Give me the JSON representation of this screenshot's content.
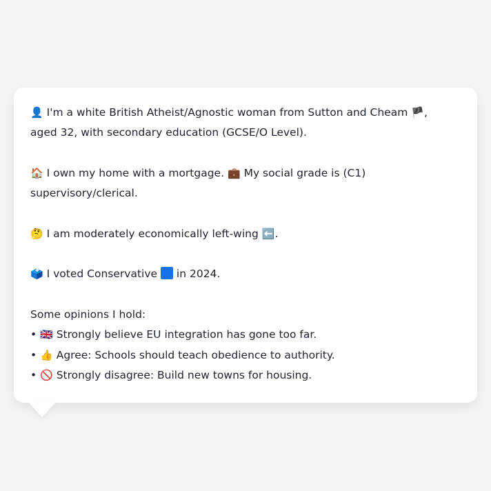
{
  "persona": {
    "identity": {
      "icon": "👤",
      "text1": "I'm a white British Atheist/Agnostic woman from Sutton and Cheam",
      "flag": "🏴",
      "text2": ",",
      "line2": "aged 32, with secondary education (GCSE/O Level)."
    },
    "home": {
      "icon": "🏠",
      "text1": "I own my home with a mortgage.",
      "icon2": "💼",
      "text2": "My social grade is (C1)",
      "line2": "supervisory/clerical."
    },
    "economics": {
      "icon": "🤔",
      "text": "I am moderately economically left-wing",
      "icon2": "⬅️",
      "end": "."
    },
    "vote": {
      "icon": "🗳️",
      "text1": "I voted Conservative",
      "party_color": "#1473e6",
      "text2": "in 2024."
    },
    "opinions_heading": "Some opinions I hold:",
    "opinions": [
      {
        "bullet": "•",
        "icon": "🇬🇧",
        "text": "Strongly believe EU integration has gone too far."
      },
      {
        "bullet": "•",
        "icon": "👍",
        "text": "Agree: Schools should teach obedience to authority."
      },
      {
        "bullet": "•",
        "icon": "🚫",
        "text": "Strongly disagree: Build new towns for housing."
      }
    ]
  }
}
